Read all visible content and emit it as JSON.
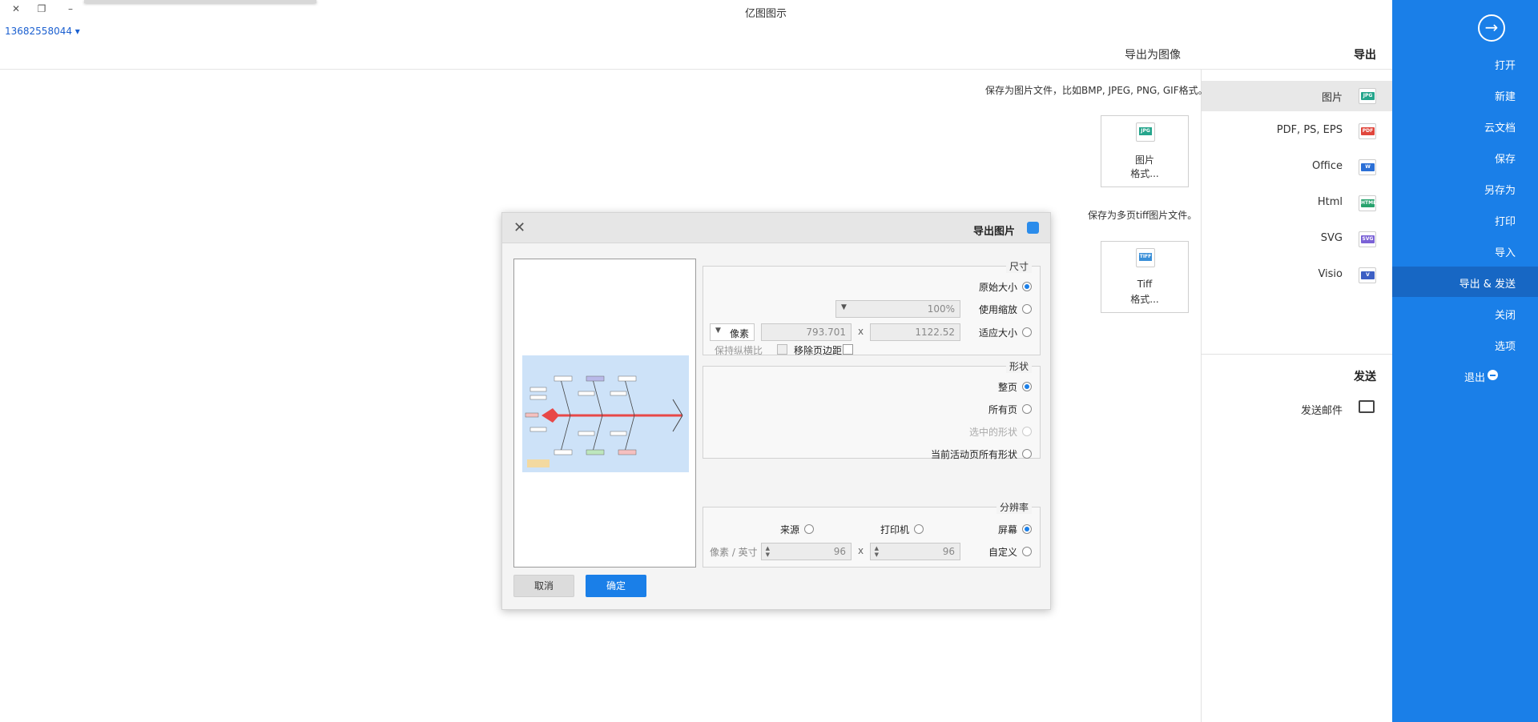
{
  "window": {
    "title": "亿图图示",
    "user": "13682558044 ▾",
    "controls": {
      "minimize": "–",
      "restore": "❐",
      "close": "✕"
    }
  },
  "header": {
    "export_title": "导出",
    "export_image_title": "导出为图像"
  },
  "sidebar": {
    "back_icon": "arrow-right-circle-icon",
    "items": [
      {
        "label": "打开"
      },
      {
        "label": "新建"
      },
      {
        "label": "云文档"
      },
      {
        "label": "保存"
      },
      {
        "label": "另存为"
      },
      {
        "label": "打印"
      },
      {
        "label": "导入"
      },
      {
        "label": "导出 & 发送"
      },
      {
        "label": "关闭"
      },
      {
        "label": "选项"
      },
      {
        "label": "退出"
      }
    ],
    "accent_color": "#1a7fe8"
  },
  "export_types": [
    {
      "label": "图片",
      "badge": "JPG",
      "color": "#25a58c"
    },
    {
      "label": "PDF, PS, EPS",
      "badge": "PDF",
      "color": "#e0463c"
    },
    {
      "label": "Office",
      "badge": "W",
      "color": "#2b6fd6"
    },
    {
      "label": "Html",
      "badge": "HTML",
      "color": "#27a26d"
    },
    {
      "label": "SVG",
      "badge": "SVG",
      "color": "#7b62d6"
    },
    {
      "label": "Visio",
      "badge": "V",
      "color": "#3d5fc4"
    }
  ],
  "send": {
    "header": "发送",
    "mail_label": "发送邮件"
  },
  "content": {
    "desc_image": "保存为图片文件，比如BMP, JPEG, PNG, GIF格式。",
    "desc_tiff": "保存为多页tiff图片文件。",
    "card_image": {
      "line1": "图片",
      "line2": "格式...",
      "badge": "JPG"
    },
    "card_tiff": {
      "line1": "Tiff",
      "line2": "格式...",
      "badge": "TIFF"
    }
  },
  "dialog": {
    "title": "导出图片",
    "size_group": {
      "label": "尺寸",
      "original": "原始大小",
      "use_zoom": "使用缩放",
      "zoom_value": "100%",
      "fit_size": "适应大小",
      "width": "1122.52",
      "x": "x",
      "height": "793.701",
      "unit": "像素",
      "remove_margin": "移除页边距",
      "keep_ratio": "保持纵横比"
    },
    "shape_group": {
      "label": "形状",
      "whole_page": "整页",
      "all_pages": "所有页",
      "selected": "选中的形状",
      "current_page_shapes": "当前活动页所有形状"
    },
    "resolution_group": {
      "label": "分辨率",
      "screen": "屏幕",
      "printer": "打印机",
      "source": "来源",
      "custom": "自定义",
      "dpi_x": "96",
      "x": "x",
      "dpi_y": "96",
      "unit": "像素 / 英寸"
    },
    "ok": "确定",
    "cancel": "取消"
  }
}
